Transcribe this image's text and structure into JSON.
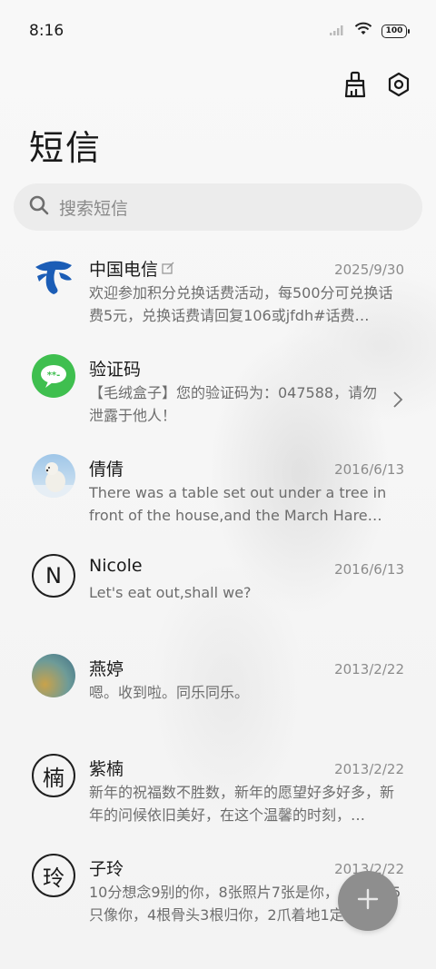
{
  "status": {
    "time": "8:16",
    "battery": "100"
  },
  "header": {
    "title": "短信"
  },
  "search": {
    "placeholder": "搜索短信"
  },
  "conversations": [
    {
      "name": "中国电信",
      "date": "2025/9/30",
      "preview": "欢迎参加积分兑换话费活动，每500分可兑换话费5元，兑换话费请回复106或jfdh#话费…",
      "avatar": "china-telecom-logo"
    },
    {
      "name": "验证码",
      "date": "",
      "preview": "【毛绒盒子】您的验证码为：047588，请勿泄露于他人！",
      "avatar": "verification-code-icon"
    },
    {
      "name": "倩倩",
      "date": "2016/6/13",
      "preview": "There was a table set out under a tree in front of the house,and the March Hare an…",
      "avatar": "polar-bear-photo"
    },
    {
      "name": "Nicole",
      "date": "2016/6/13",
      "preview": "Let's eat out,shall we?",
      "avatar_letter": "N"
    },
    {
      "name": "燕婷",
      "date": "2013/2/22",
      "preview": "嗯。收到啦。同乐同乐。",
      "avatar": "sea-photo"
    },
    {
      "name": "紫楠",
      "date": "2013/2/22",
      "preview": "新年的祝福数不胜数，新年的愿望好多好多，新年的问候依旧美好，在这个温馨的时刻，…",
      "avatar_letter": "楠"
    },
    {
      "name": "子玲",
      "date": "2013/2/22",
      "preview": "10分想念9别的你，8张照片7张是你，6只小狗5只像你，4根骨头3根归你，2爪着地1定…",
      "avatar_letter": "玲"
    }
  ],
  "colors": {
    "accent_green": "#3fbf4f",
    "telecom_blue": "#1b5db6",
    "fab": "#8e8e8e"
  }
}
